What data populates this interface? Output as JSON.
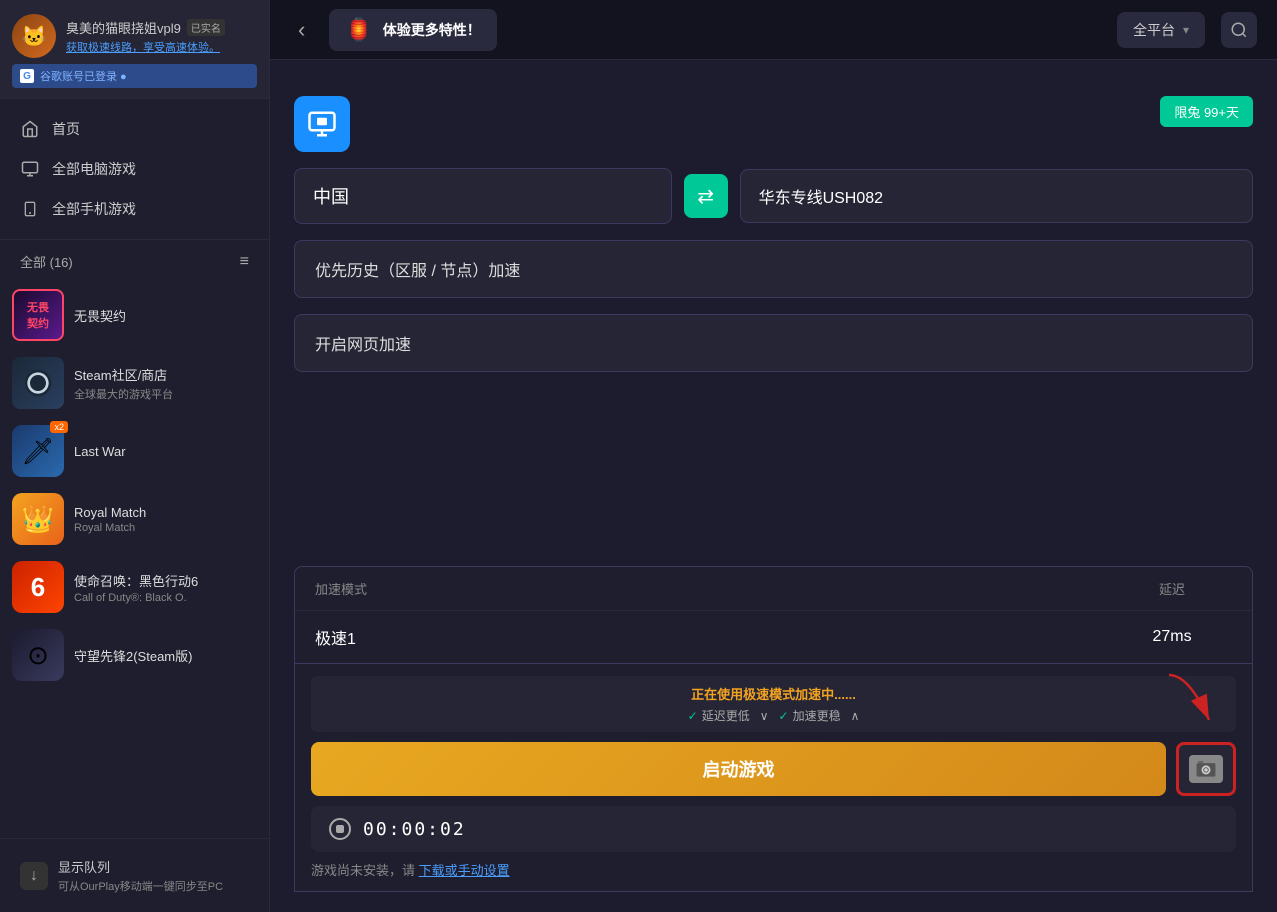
{
  "user": {
    "name": "臭美的猫眼挠姐vpl9",
    "verified_label": "已实名",
    "sub_text": "获取极速线路，享受高速体验。",
    "google_text": "谷歌账号已登录 ●"
  },
  "nav": {
    "home": "首页",
    "pc_games": "全部电脑游戏",
    "mobile_games": "全部手机游戏"
  },
  "section_header": "全部 (16)",
  "games": [
    {
      "id": "wuji",
      "name": "无畏契约",
      "sub": "",
      "emoji": "W",
      "badge": ""
    },
    {
      "id": "steam",
      "name": "Steam社区/商店",
      "sub": "全球最大的游戏平台",
      "emoji": "S",
      "badge": ""
    },
    {
      "id": "lastwar",
      "name": "Last War",
      "sub": "",
      "emoji": "⚔",
      "badge": "x2"
    },
    {
      "id": "royalmatch",
      "name": "Royal Match",
      "sub": "Royal Match",
      "emoji": "👑",
      "badge": ""
    },
    {
      "id": "cod",
      "name": "使命召唤：黑色行动6",
      "sub": "Call of Duty®: Black O.",
      "emoji": "6",
      "badge": ""
    },
    {
      "id": "overwatch",
      "name": "守望先锋2(Steam版)",
      "sub": "",
      "emoji": "⊙",
      "badge": ""
    }
  ],
  "sidebar_bottom": {
    "title": "显示队列",
    "sub": "可从OurPlay移动端一键同步至PC"
  },
  "topbar": {
    "promo_text": "体验更多特性！",
    "platform_text": "全平台"
  },
  "main": {
    "limit_badge": "限兔  99+天",
    "country_from": "中国",
    "server_to": "华东专线USH082",
    "priority_text": "优先历史（区服 / 节点）加速",
    "web_accel_text": "开启网页加速",
    "speed_table": {
      "col_mode": "加速模式",
      "col_delay": "延迟",
      "row_mode": "极速1",
      "row_delay": "27ms"
    },
    "status": {
      "main": "正在使用极速模式加速中......",
      "sub1": "延迟更低",
      "sub2": "加速更稳"
    },
    "start_btn": "启动游戏",
    "timer": "00:00:02",
    "not_installed": "游戏尚未安装，请",
    "download_link": "下载或手动设置"
  }
}
